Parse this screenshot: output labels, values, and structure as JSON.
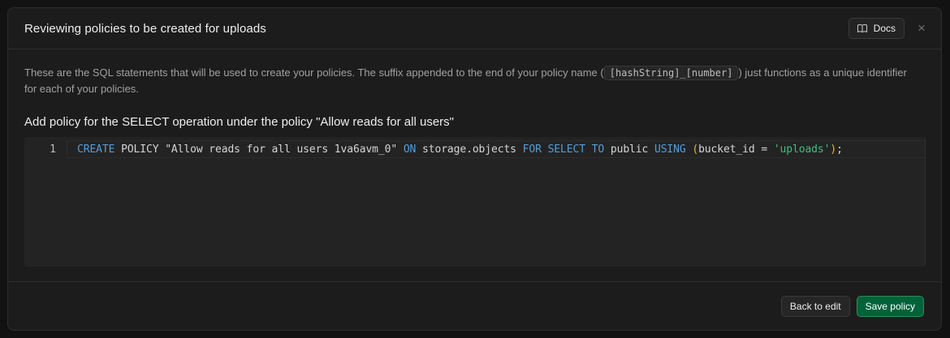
{
  "modal": {
    "title": "Reviewing policies to be created for uploads",
    "docs_label": "Docs",
    "close_symbol": "×"
  },
  "description": {
    "before": "These are the SQL statements that will be used to create your policies. The suffix appended to the end of your policy name (",
    "code": "[hashString]_[number]",
    "after": ") just functions as a unique identifier for each of your policies."
  },
  "policy": {
    "heading": "Add policy for the SELECT operation under the policy \"Allow reads for all users\"",
    "line_number": "1",
    "tokens": {
      "t1": "CREATE",
      "t2": " POLICY \"Allow reads for all users 1va6avm_0\" ",
      "t3": "ON",
      "t4": " storage.objects ",
      "t5": "FOR",
      "t6": " ",
      "t7": "SELECT",
      "t8": " ",
      "t9": "TO",
      "t10": " public ",
      "t11": "USING",
      "t12": " ",
      "t13": "(",
      "t14": "bucket_id = ",
      "t15": "'uploads'",
      "t16": ")",
      "t17": ";"
    }
  },
  "footer": {
    "back_label": "Back to edit",
    "save_label": "Save policy"
  },
  "icons": {
    "docs": "book-icon",
    "close": "close-icon"
  },
  "colors": {
    "primary": "#006239",
    "keyword": "#569cd6",
    "string": "#3fbf7f",
    "paren": "#e2b93d"
  }
}
